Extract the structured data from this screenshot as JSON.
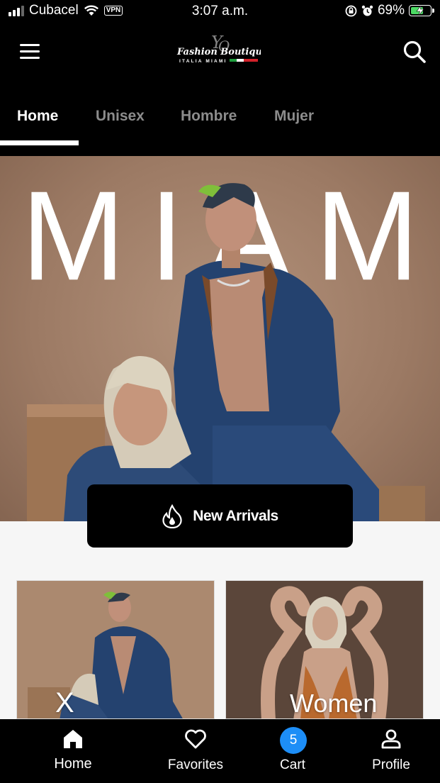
{
  "status_bar": {
    "carrier": "Cubacel",
    "vpn": "VPN",
    "time": "3:07 a.m.",
    "battery": "69%",
    "battery_level": 0.69
  },
  "header": {
    "logo_script": "Fashion Boutique",
    "logo_sub": "ITALIA MIAMI",
    "logo_mono": "YO"
  },
  "tabs": [
    {
      "label": "Home",
      "active": true
    },
    {
      "label": "Unisex",
      "active": false
    },
    {
      "label": "Hombre",
      "active": false
    },
    {
      "label": "Mujer",
      "active": false
    }
  ],
  "hero": {
    "word": "MIAMI",
    "cta_label": "New Arrivals"
  },
  "cards": {
    "left_label": "X",
    "right_label": "Women"
  },
  "bottom_nav": {
    "items": [
      {
        "label": "Home",
        "icon": "home-icon"
      },
      {
        "label": "Favorites",
        "icon": "heart-icon"
      },
      {
        "label": "Cart",
        "icon": "cart-icon"
      },
      {
        "label": "Profile",
        "icon": "profile-icon"
      }
    ],
    "cart_count": "5"
  },
  "colors": {
    "accent": "#1d8ef7",
    "battery_fill": "#4cd964",
    "header_bg": "#000000",
    "inactive_tab": "#8c8c8c"
  }
}
